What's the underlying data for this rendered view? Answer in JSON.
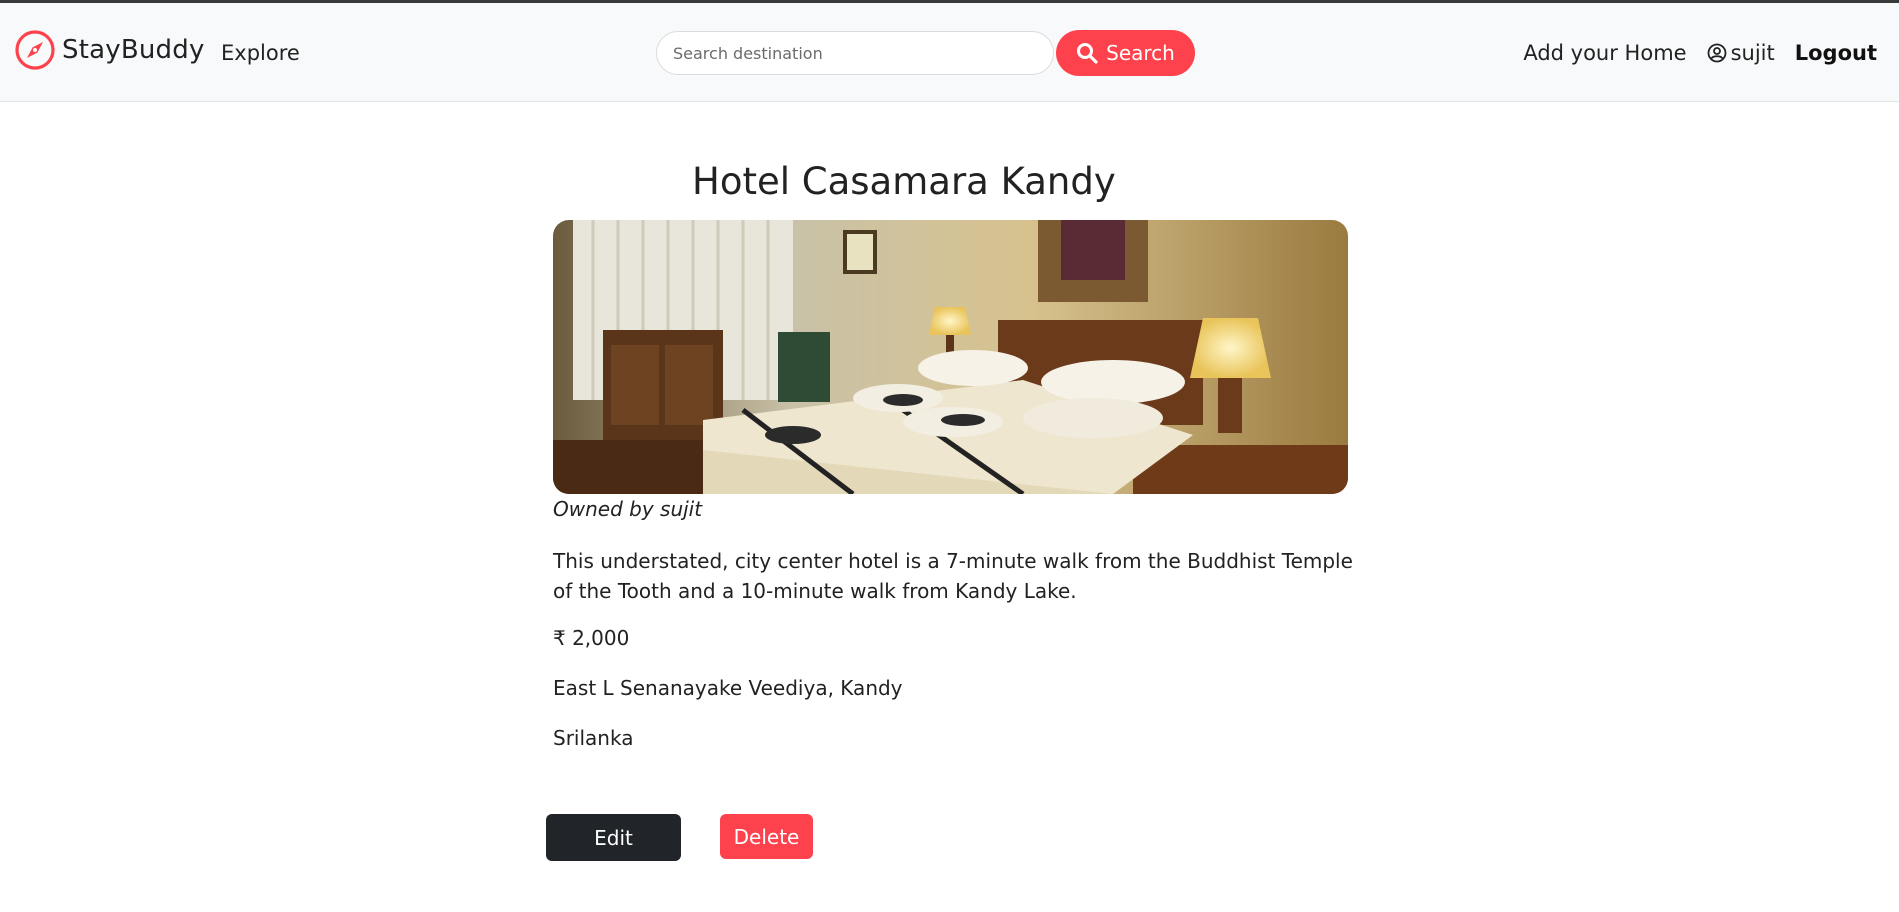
{
  "brand": {
    "name": "StayBuddy",
    "icon": "compass-icon",
    "accent_color": "#fe424d"
  },
  "nav": {
    "explore": "Explore",
    "add_home": "Add your Home",
    "username": "sujit",
    "logout": "Logout"
  },
  "search": {
    "placeholder": "Search destination",
    "value": "",
    "button_label": "Search",
    "icon": "search-icon"
  },
  "listing": {
    "title": "Hotel Casamara Kandy",
    "image_alt": "hotel-room-photo",
    "owner_text": "Owned by sujit",
    "description": "This understated, city center hotel is a 7-minute walk from the Buddhist Temple of the Tooth and a 10-minute walk from Kandy Lake.",
    "price": "₹ 2,000",
    "location": "East L Senanayake Veediya, Kandy",
    "country": "Srilanka"
  },
  "actions": {
    "edit": "Edit",
    "delete": "Delete",
    "edit_color": "#212529",
    "delete_color": "#fe424d"
  }
}
